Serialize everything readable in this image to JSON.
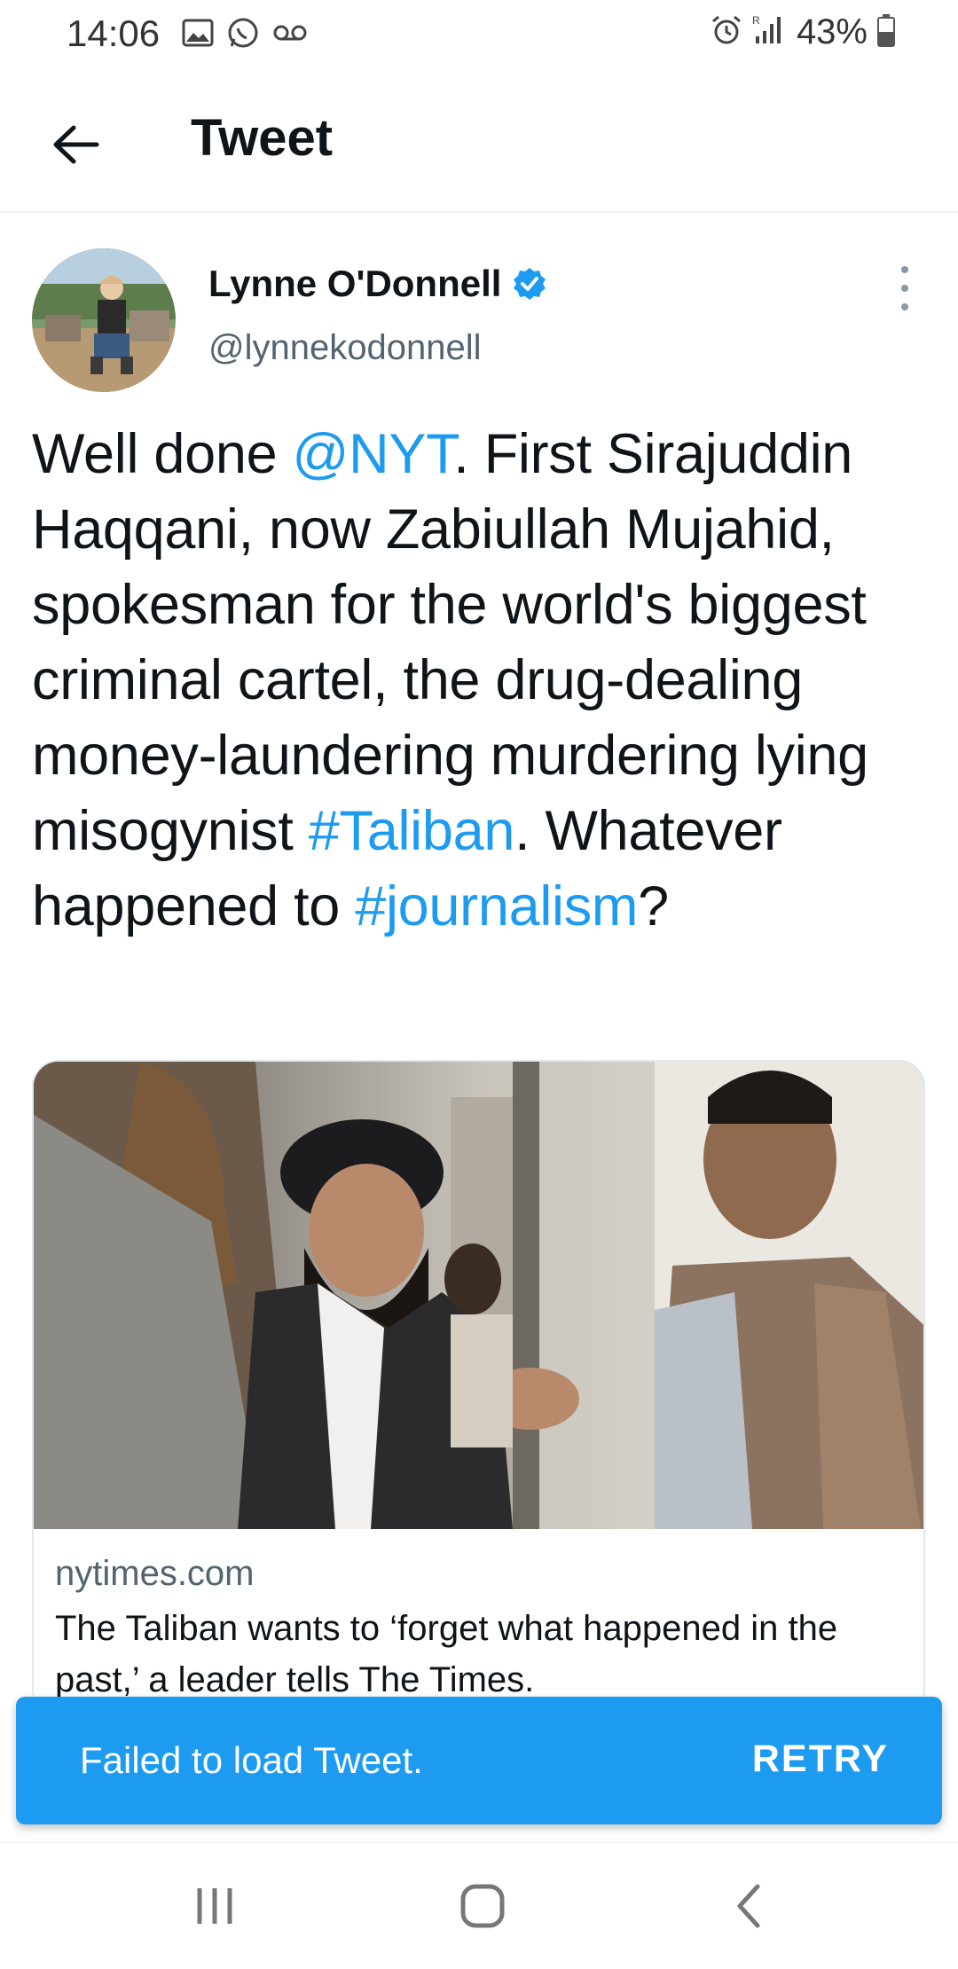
{
  "status": {
    "time": "14:06",
    "battery": "43%",
    "left_icons": [
      "gallery-icon",
      "whatsapp-icon",
      "voicemail-icon"
    ],
    "right_icons": [
      "alarm-icon",
      "signal-icon",
      "battery-icon"
    ]
  },
  "header": {
    "title": "Tweet",
    "back_icon": "arrow-left-icon"
  },
  "tweet": {
    "author_name": "Lynne O'Donnell",
    "handle": "@lynnekodonnell",
    "verified": true,
    "text_segments": [
      {
        "t": "Well done ",
        "link": false
      },
      {
        "t": "@NYT",
        "link": true
      },
      {
        "t": ". First Sirajuddin Haqqani, now Zabiullah Mujahid, spokesman for the world's biggest criminal cartel, the drug-dealing money-laundering murdering lying misogynist ",
        "link": false
      },
      {
        "t": "#Taliban",
        "link": true
      },
      {
        "t": ".  Whatever happened to ",
        "link": false
      },
      {
        "t": "#journalism",
        "link": true
      },
      {
        "t": "?",
        "link": false
      }
    ],
    "card": {
      "domain": "nytimes.com",
      "title": "The Taliban wants to ‘forget what happened in the past,’ a leader tells The Times."
    }
  },
  "snackbar": {
    "message": "Failed to load Tweet.",
    "action": "RETRY"
  },
  "colors": {
    "accent": "#1d9bf0",
    "text": "#0f1419",
    "secondary": "#536471"
  }
}
